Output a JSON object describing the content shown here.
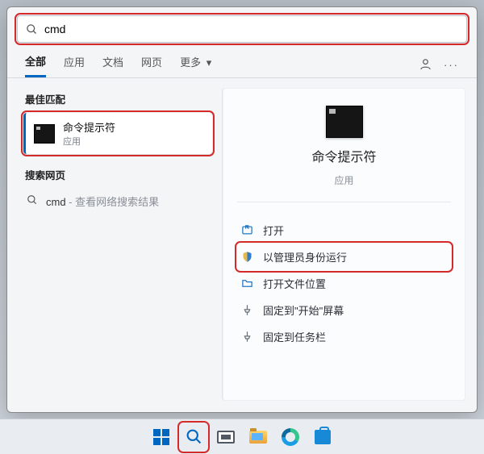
{
  "search": {
    "value": "cmd"
  },
  "tabs": {
    "items": [
      "全部",
      "应用",
      "文档",
      "网页",
      "更多"
    ],
    "active_index": 0
  },
  "sections": {
    "best_match": "最佳匹配",
    "search_web": "搜索网页"
  },
  "best": {
    "title": "命令提示符",
    "subtitle": "应用"
  },
  "web_result": {
    "term": "cmd",
    "suffix": " - 查看网络搜索结果"
  },
  "detail": {
    "title": "命令提示符",
    "subtitle": "应用",
    "actions": {
      "open": "打开",
      "run_admin": "以管理员身份运行",
      "open_location": "打开文件位置",
      "pin_start": "固定到\"开始\"屏幕",
      "pin_taskbar": "固定到任务栏"
    }
  },
  "colors": {
    "accent": "#0067c0",
    "highlight": "#d42a2a"
  }
}
